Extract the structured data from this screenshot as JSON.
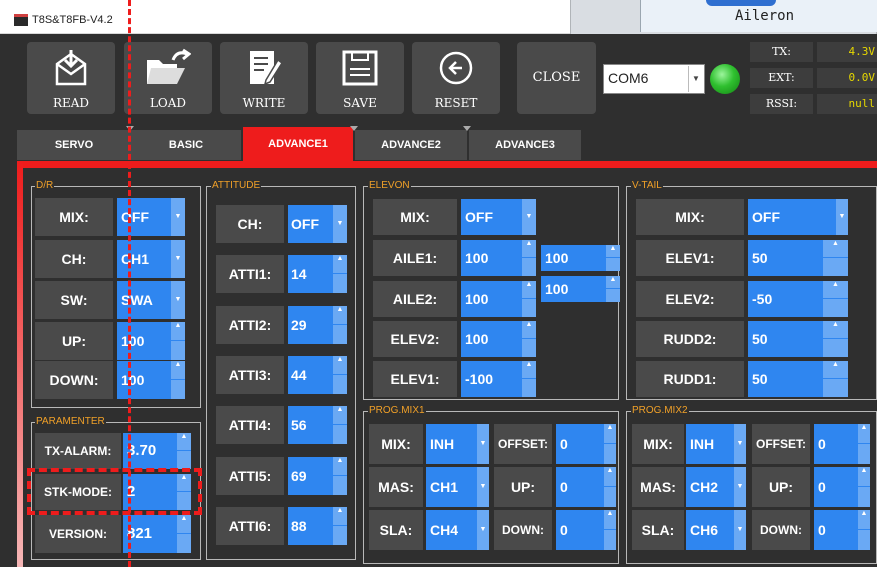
{
  "window": {
    "title": "T8S&T8FB-V4.2"
  },
  "overlay": {
    "caption": "Aileron"
  },
  "toolbar": {
    "read": "READ",
    "load": "LOAD",
    "write": "WRITE",
    "save": "SAVE",
    "reset": "RESET",
    "close": "CLOSE"
  },
  "connection": {
    "port": "COM6",
    "led_color": "#2fc02f"
  },
  "status": {
    "tx_label": "TX:",
    "tx_value": "4.3V",
    "ext_label": "EXT:",
    "ext_value": "0.0V",
    "rssi_label": "RSSI:",
    "rssi_value": "null"
  },
  "tabs": [
    "SERVO",
    "BASIC",
    "ADVANCE1",
    "ADVANCE2",
    "ADVANCE3"
  ],
  "active_tab": "ADVANCE1",
  "dr": {
    "title": "D/R",
    "fields": [
      {
        "label": "MIX:",
        "value": "OFF"
      },
      {
        "label": "CH:",
        "value": "CH1"
      },
      {
        "label": "SW:",
        "value": "SWA"
      },
      {
        "label": "UP:",
        "value": "100"
      },
      {
        "label": "DOWN:",
        "value": "100"
      }
    ]
  },
  "parameter": {
    "title": "PARAMENTER",
    "fields": [
      {
        "label": "TX-ALARM:",
        "value": "3.70"
      },
      {
        "label": "STK-MODE:",
        "value": "2"
      },
      {
        "label": "VERSION:",
        "value": "821"
      }
    ]
  },
  "attitude": {
    "title": "ATTITUDE",
    "fields": [
      {
        "label": "CH:",
        "value": "OFF"
      },
      {
        "label": "ATTI1:",
        "value": "14"
      },
      {
        "label": "ATTI2:",
        "value": "29"
      },
      {
        "label": "ATTI3:",
        "value": "44"
      },
      {
        "label": "ATTI4:",
        "value": "56"
      },
      {
        "label": "ATTI5:",
        "value": "69"
      },
      {
        "label": "ATTI6:",
        "value": "88"
      }
    ]
  },
  "elevon": {
    "title": "ELEVON",
    "fields": [
      {
        "label": "MIX:",
        "value": "OFF"
      },
      {
        "label": "AILE1:",
        "value": "100"
      },
      {
        "label": "AILE2:",
        "value": "100"
      },
      {
        "label": "ELEV2:",
        "value": "100"
      },
      {
        "label": "ELEV1:",
        "value": "-100"
      }
    ],
    "side_values": [
      "100",
      "100"
    ]
  },
  "vtail": {
    "title": "V-TAIL",
    "fields": [
      {
        "label": "MIX:",
        "value": "OFF"
      },
      {
        "label": "ELEV1:",
        "value": "50"
      },
      {
        "label": "ELEV2:",
        "value": "-50"
      },
      {
        "label": "RUDD2:",
        "value": "50"
      },
      {
        "label": "RUDD1:",
        "value": "50"
      }
    ]
  },
  "progmix1": {
    "title": "PROG.MIX1",
    "mix_label": "MIX:",
    "mix_value": "INH",
    "mas_label": "MAS:",
    "mas_value": "CH1",
    "sla_label": "SLA:",
    "sla_value": "CH4",
    "offset_label": "OFFSET:",
    "offset_value": "0",
    "up_label": "UP:",
    "up_value": "0",
    "down_label": "DOWN:",
    "down_value": "0"
  },
  "progmix2": {
    "title": "PROG.MIX2",
    "mix_label": "MIX:",
    "mix_value": "INH",
    "mas_label": "MAS:",
    "mas_value": "CH2",
    "sla_label": "SLA:",
    "sla_value": "CH6",
    "offset_label": "OFFSET:",
    "offset_value": "0",
    "up_label": "UP:",
    "up_value": "0",
    "down_label": "DOWN:",
    "down_value": "0"
  },
  "colors": {
    "accent_red": "#ee1c1c",
    "field_blue": "#2f86f0",
    "group_title": "#f0a028",
    "status_value": "#e6d800"
  }
}
